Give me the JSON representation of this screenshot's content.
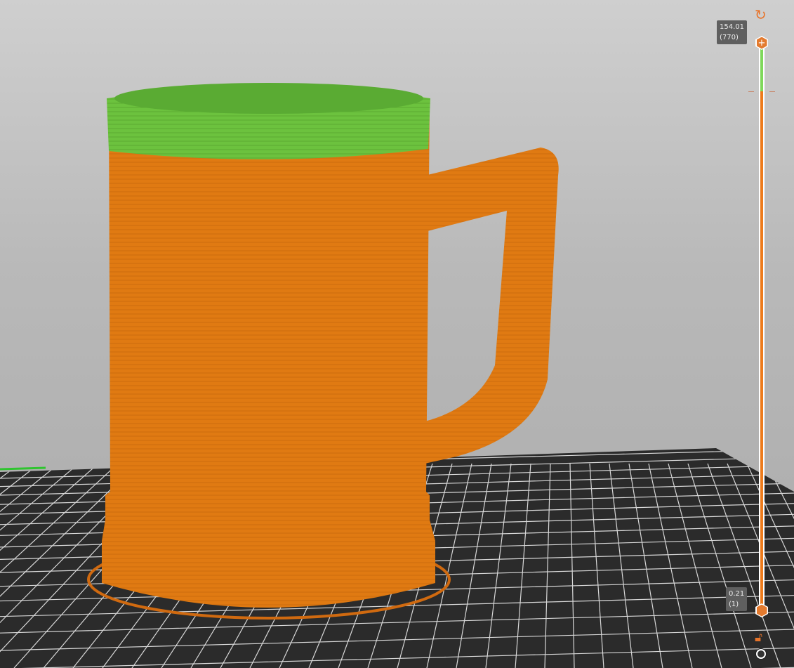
{
  "layer_slider": {
    "upper": {
      "height": "154.01",
      "layer": "(770)"
    },
    "lower": {
      "height": "0.21",
      "layer": "(1)"
    },
    "colors": {
      "above": "#7fd85b",
      "printed": "#ed7b1c",
      "thumb": "#e37a2e"
    }
  },
  "icons": [
    "undo-arrow-icon",
    "plus-icon",
    "unlock-icon",
    "settings-cog-icon"
  ]
}
